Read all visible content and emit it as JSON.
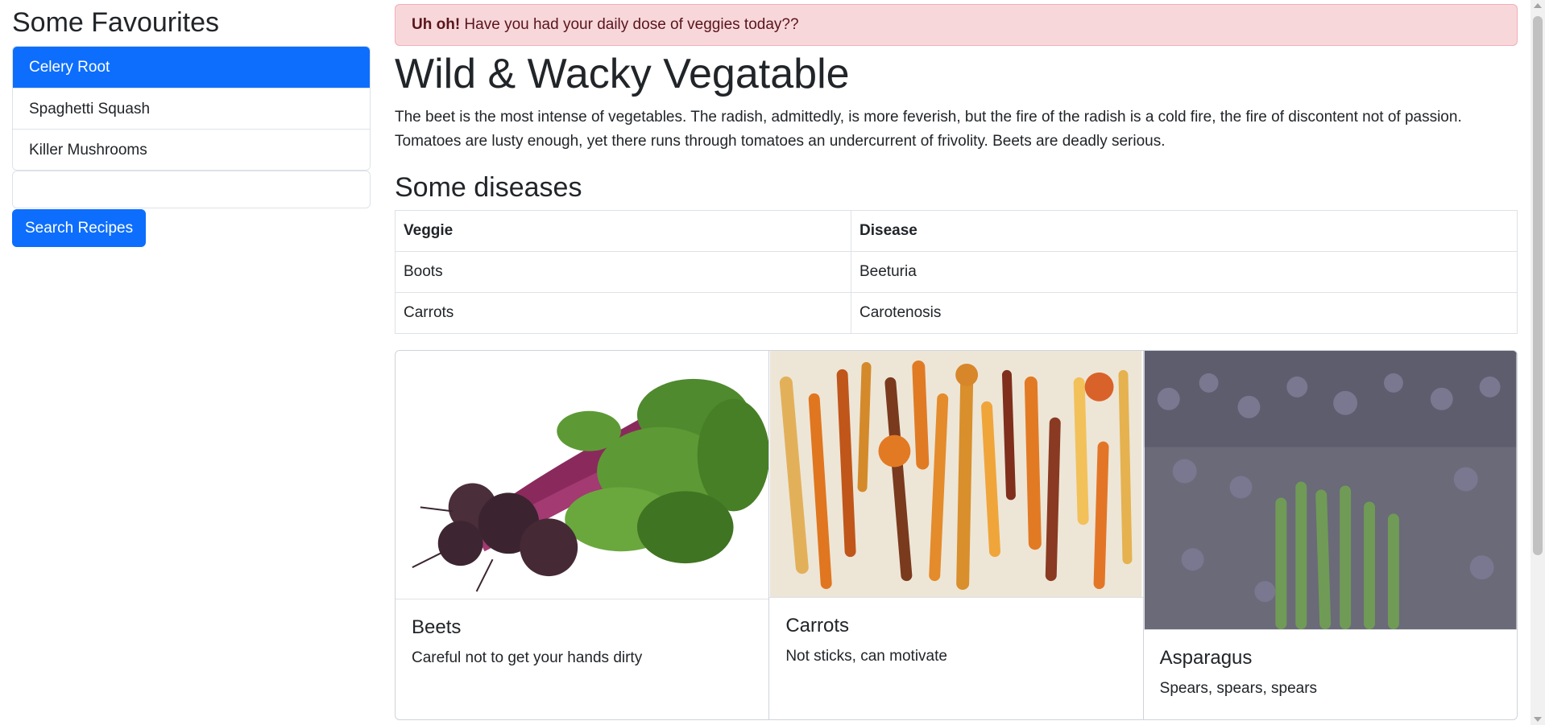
{
  "sidebar": {
    "title": "Some Favourites",
    "items": [
      {
        "label": "Celery Root"
      },
      {
        "label": "Spaghetti Squash"
      },
      {
        "label": "Killer Mushrooms"
      }
    ],
    "search_value": "",
    "search_button": "Search Recipes"
  },
  "alert": {
    "strong": "Uh oh!",
    "text": " Have you had your daily dose of veggies today??"
  },
  "main": {
    "title": "Wild & Wacky Vegatable",
    "paragraph": "The beet is the most intense of vegetables. The radish, admittedly, is more feverish, but the fire of the radish is a cold fire, the fire of discontent not of passion. Tomatoes are lusty enough, yet there runs through tomatoes an undercurrent of frivolity. Beets are deadly serious.",
    "table_title": "Some diseases",
    "table": {
      "headers": [
        "Veggie",
        "Disease"
      ],
      "rows": [
        [
          "Boots",
          "Beeturia"
        ],
        [
          "Carrots",
          "Carotenosis"
        ]
      ]
    }
  },
  "cards": [
    {
      "title": "Beets",
      "text": "Careful not to get your hands dirty",
      "image": "beets-photo"
    },
    {
      "title": "Carrots",
      "text": "Not sticks, can motivate",
      "image": "carrots-photo"
    },
    {
      "title": "Asparagus",
      "text": "Spears, spears, spears",
      "image": "asparagus-photo"
    }
  ],
  "colors": {
    "primary": "#0d6efd",
    "alert_bg": "#f8d7da",
    "alert_text": "#58151c"
  }
}
